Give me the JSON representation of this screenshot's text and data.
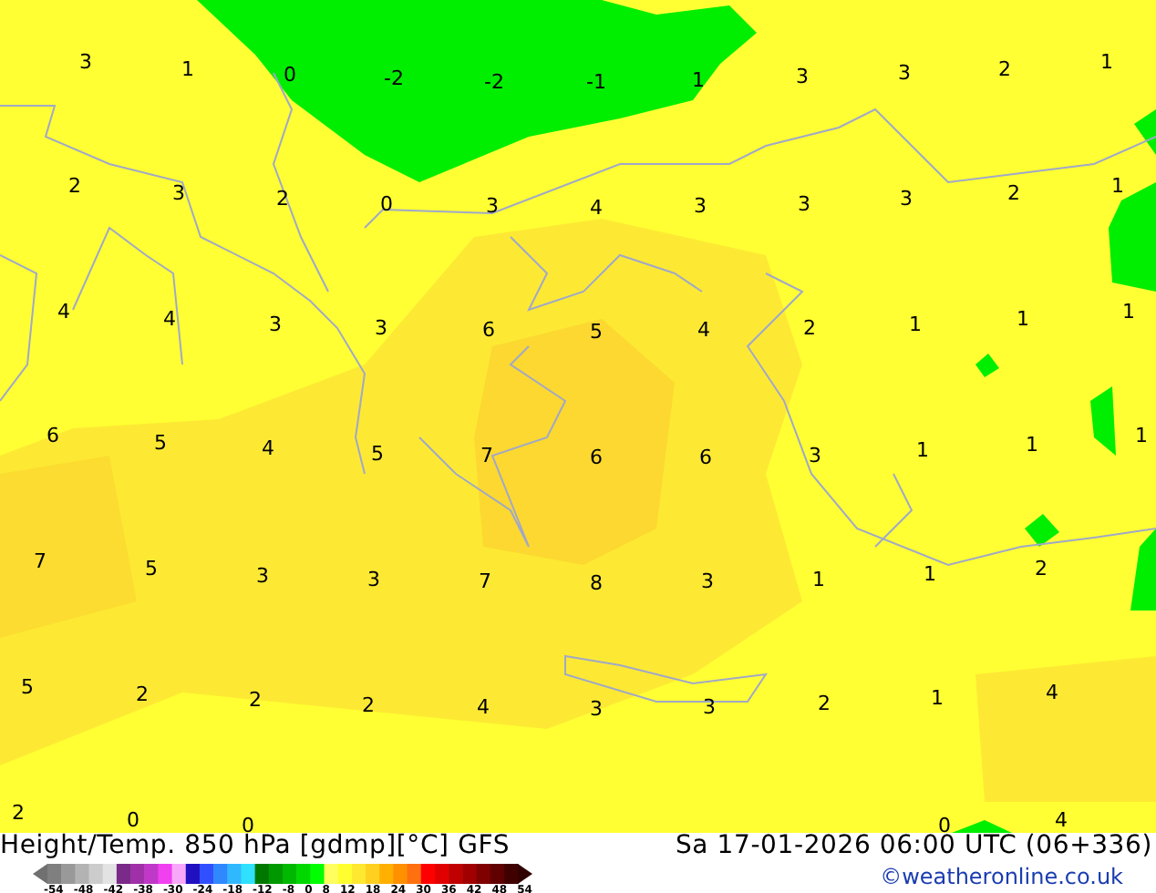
{
  "map": {
    "value_rows": [
      [
        "3",
        "1",
        "0",
        "-2",
        "-2",
        "-1",
        "1",
        "3",
        "3",
        "2",
        "1"
      ],
      [
        "2",
        "3",
        "2",
        "0",
        "3",
        "4",
        "3",
        "3",
        "3",
        "2",
        "1"
      ],
      [
        "4",
        "4",
        "3",
        "3",
        "6",
        "5",
        "4",
        "2",
        "1",
        "1",
        "1"
      ],
      [
        "6",
        "5",
        "4",
        "5",
        "7",
        "6",
        "6",
        "3",
        "1",
        "1",
        "1"
      ],
      [
        "7",
        "5",
        "3",
        "3",
        "7",
        "8",
        "3",
        "1",
        "1",
        "2"
      ],
      [
        "5",
        "2",
        "2",
        "2",
        "4",
        "3",
        "3",
        "2",
        "1",
        "4"
      ],
      [
        "2",
        "0",
        "0",
        "0",
        "4"
      ]
    ]
  },
  "footer": {
    "title": "Height/Temp. 850 hPa [gdmp][°C] GFS",
    "timestamp": "Sa 17-01-2026 06:00 UTC (06+336)",
    "credit": "©weatheronline.co.uk",
    "scale_ticks": [
      "-54",
      "-48",
      "-42",
      "-38",
      "-30",
      "-24",
      "-18",
      "-12",
      "-8",
      "0",
      "8",
      "12",
      "18",
      "24",
      "30",
      "36",
      "42",
      "48",
      "54"
    ]
  }
}
